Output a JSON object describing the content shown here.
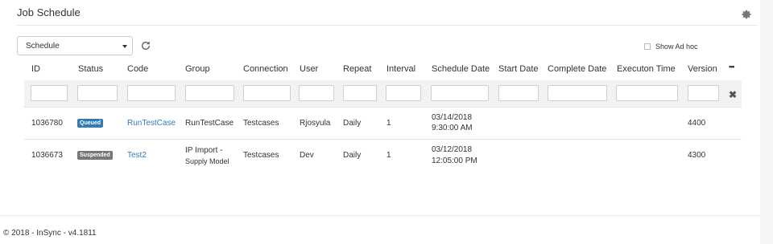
{
  "panel": {
    "title": "Job Schedule"
  },
  "toolbar": {
    "view_select": "Schedule",
    "show_adhoc_label": "Show Ad hoc"
  },
  "table": {
    "columns": [
      "ID",
      "Status",
      "Code",
      "Group",
      "Connection",
      "User",
      "Repeat",
      "Interval",
      "Schedule Date",
      "Start Date",
      "Complete Date",
      "Executon Time",
      "Version"
    ],
    "menu_glyph": "•••",
    "clear_glyph": "✖",
    "rows": [
      {
        "id": "1036780",
        "status": "Queued",
        "code": "RunTestCase",
        "group_line1": "RunTestCase",
        "group_line2": "",
        "connection": "Testcases",
        "user": "Rjosyula",
        "repeat": "Daily",
        "interval": "1",
        "schedule_date_line1": "03/14/2018",
        "schedule_date_line2": "9:30:00 AM",
        "start_date": "",
        "complete_date": "",
        "execution_time": "",
        "version": "4400"
      },
      {
        "id": "1036673",
        "status": "Suspended",
        "code": "Test2",
        "group_line1": "IP Import -",
        "group_line2": "Supply Model",
        "connection": "Testcases",
        "user": "Dev",
        "repeat": "Daily",
        "interval": "1",
        "schedule_date_line1": "03/12/2018",
        "schedule_date_line2": "12:05:00 PM",
        "start_date": "",
        "complete_date": "",
        "execution_time": "",
        "version": "4300"
      }
    ]
  },
  "status_colors": {
    "Queued": "#337ab7",
    "Suspended": "#777777"
  },
  "footer": {
    "text": "© 2018 - InSync - v4.1811"
  }
}
